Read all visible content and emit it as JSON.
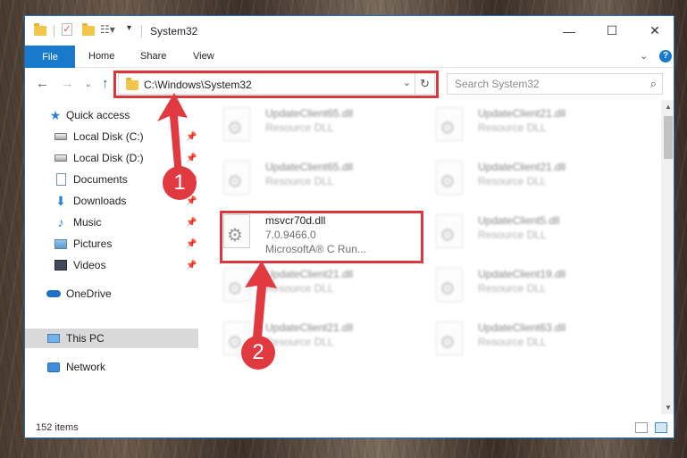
{
  "window": {
    "title": "System32",
    "controls": {
      "minimize": "—",
      "maximize": "☐",
      "close": "✕"
    }
  },
  "ribbon": {
    "tabs": [
      "File",
      "Home",
      "Share",
      "View"
    ]
  },
  "navigation": {
    "address": "C:\\Windows\\System32",
    "search_placeholder": "Search System32"
  },
  "sidebar": {
    "items": [
      {
        "label": "Quick access",
        "icon": "star-icon",
        "pinned": false
      },
      {
        "label": "Local Disk (C:)",
        "icon": "disk-icon",
        "pinned": true
      },
      {
        "label": "Local Disk (D:)",
        "icon": "disk-icon",
        "pinned": true
      },
      {
        "label": "Documents",
        "icon": "document-icon",
        "pinned": true
      },
      {
        "label": "Downloads",
        "icon": "download-icon",
        "pinned": true
      },
      {
        "label": "Music",
        "icon": "music-icon",
        "pinned": true
      },
      {
        "label": "Pictures",
        "icon": "picture-icon",
        "pinned": true
      },
      {
        "label": "Videos",
        "icon": "video-icon",
        "pinned": true
      },
      {
        "label": "OneDrive",
        "icon": "cloud-icon",
        "pinned": false
      },
      {
        "label": "This PC",
        "icon": "computer-icon",
        "pinned": false,
        "selected": true
      },
      {
        "label": "Network",
        "icon": "network-icon",
        "pinned": false
      }
    ]
  },
  "files": [
    {
      "name": "UpdateClient65.dll",
      "desc": "Resource DLL"
    },
    {
      "name": "UpdateClient21.dll",
      "desc": "Resource DLL"
    },
    {
      "name": "UpdateClient65.dll",
      "desc": "Resource DLL"
    },
    {
      "name": "UpdateClient21.dll",
      "desc": "Resource DLL"
    },
    {
      "name": "msvcr70d.dll",
      "version": "7.0.9466.0",
      "desc": "MicrosoftA® C Run...",
      "highlighted": true
    },
    {
      "name": "UpdateClient5.dll",
      "desc": "Resource DLL"
    },
    {
      "name": "UpdateClient21.dll",
      "desc": "Resource DLL"
    },
    {
      "name": "UpdateClient19.dll",
      "desc": "Resource DLL"
    },
    {
      "name": "UpdateClient21.dll",
      "desc": "Resource DLL"
    },
    {
      "name": "UpdateClient63.dll",
      "desc": "Resource DLL"
    }
  ],
  "status": {
    "item_count": "152 items"
  },
  "annotations": {
    "step1": "1",
    "step2": "2",
    "color": "#e0393f"
  }
}
